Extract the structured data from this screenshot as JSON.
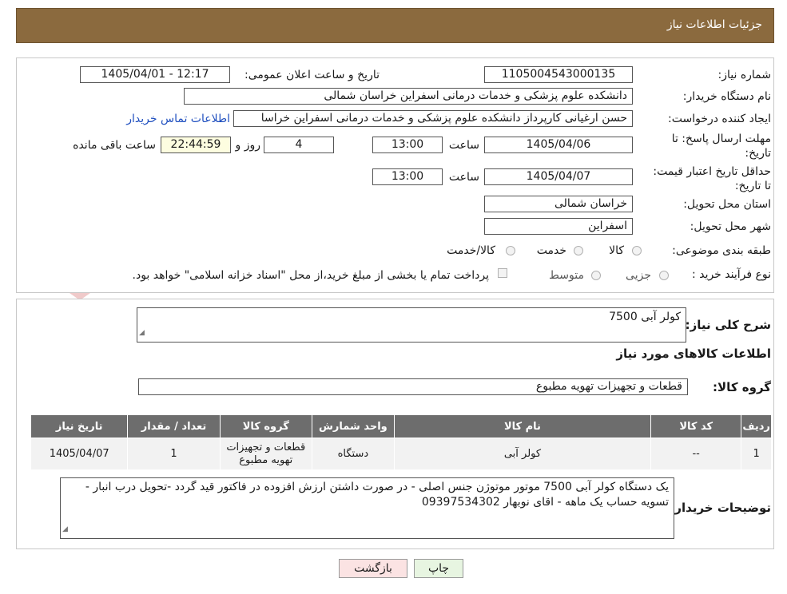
{
  "header": {
    "title": "جزئیات اطلاعات نیاز"
  },
  "watermark": {
    "text": "AriaTender.neT"
  },
  "form": {
    "need_number": {
      "label": "شماره نیاز:",
      "value": "1105004543000135"
    },
    "announce": {
      "label": "تاریخ و ساعت اعلان عمومی:",
      "value": "1405/04/01 - 12:17"
    },
    "buyer_org": {
      "label": "نام دستگاه خریدار:",
      "value": "دانشکده علوم پزشکی و خدمات درمانی اسفراین خراسان شمالی"
    },
    "requester": {
      "label": "ایجاد کننده درخواست:",
      "value": "حسن ارغیانی کارپرداز  دانشکده علوم پزشکی و خدمات درمانی اسفراین خراسا",
      "contact_link": "اطلاعات تماس خریدار"
    },
    "deadline": {
      "label": "مهلت ارسال پاسخ: تا تاریخ:",
      "date": "1405/04/06",
      "time_label": "ساعت",
      "time": "13:00",
      "days": "4",
      "days_label": "روز و",
      "remaining": "22:44:59",
      "remaining_label": "ساعت باقی مانده"
    },
    "price_validity": {
      "label": "حداقل تاریخ اعتبار قیمت: تا تاریخ:",
      "date": "1405/04/07",
      "time_label": "ساعت",
      "time": "13:00"
    },
    "province": {
      "label": "استان محل تحویل:",
      "value": "خراسان شمالی"
    },
    "city": {
      "label": "شهر محل تحویل:",
      "value": "اسفراین"
    },
    "category": {
      "label": "طبقه بندی موضوعی:",
      "options": [
        "کالا",
        "خدمت",
        "کالا/خدمت"
      ],
      "selected": "کالا"
    },
    "process": {
      "label": "نوع فرآیند خرید :",
      "options": [
        "جزیی",
        "متوسط"
      ],
      "note": "پرداخت تمام یا بخشی از مبلغ خرید،از محل \"اسناد خزانه اسلامی\" خواهد بود."
    }
  },
  "details": {
    "summary_label": "شرح کلی نیاز:",
    "summary_value": "کولر آبی 7500",
    "goods_info_title": "اطلاعات کالاهای مورد نیاز",
    "goods_group_label": "گروه کالا:",
    "goods_group_value": "قطعات و تجهیزات تهویه مطبوع",
    "table": {
      "headers": [
        "ردیف",
        "کد کالا",
        "نام کالا",
        "واحد شمارش",
        "گروه کالا",
        "تعداد / مقدار",
        "تاریخ نیاز"
      ],
      "rows": [
        [
          "1",
          "--",
          "کولر آبی",
          "دستگاه",
          "قطعات و تجهیزات تهویه مطبوع",
          "1",
          "1405/04/07"
        ]
      ]
    },
    "buyer_notes_label": "توضیحات خریدار:",
    "buyer_notes_value": "یک دستگاه کولر آبی 7500 موتور موتوژن جنس اصلی - در صورت داشتن ارزش افزوده در فاکتور قید گردد -تحویل درب انبار - تسویه حساب یک ماهه - اقای نوبهار 09397534302"
  },
  "buttons": {
    "print": "چاپ",
    "back": "بازگشت"
  },
  "colors": {
    "header_bg": "#8b6a3e",
    "table_header_bg": "#6d6d6d",
    "link": "#1f4fbf",
    "back_btn_bg": "#fbe3e3",
    "print_btn_bg": "#e7f5e1"
  }
}
